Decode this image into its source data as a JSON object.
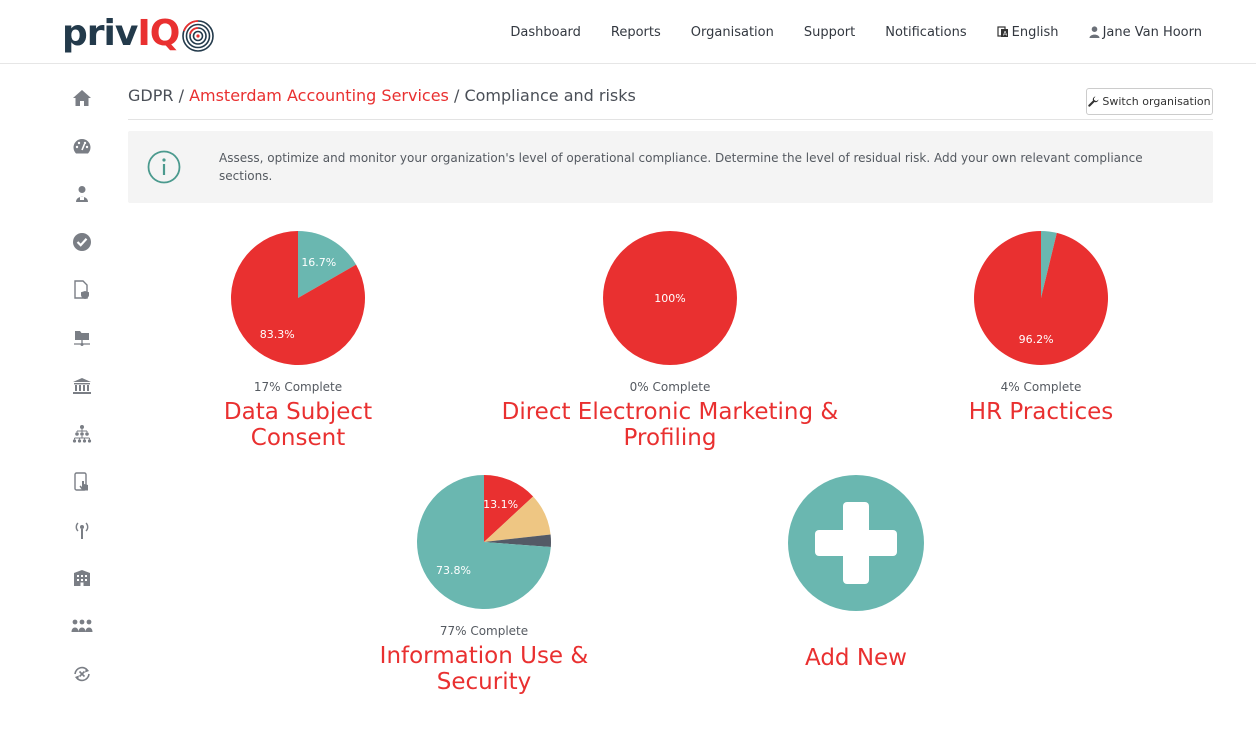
{
  "brand": {
    "logo_priv": "priv",
    "logo_iq": "IQ"
  },
  "nav": {
    "items": [
      {
        "name": "nav-dashboard",
        "label": "Dashboard"
      },
      {
        "name": "nav-reports",
        "label": "Reports"
      },
      {
        "name": "nav-organisation",
        "label": "Organisation"
      },
      {
        "name": "nav-support",
        "label": "Support"
      },
      {
        "name": "nav-notifications",
        "label": "Notifications"
      }
    ],
    "language": "English",
    "user": "Jane Van Hoorn"
  },
  "sidebar": {
    "icons": [
      "home-icon",
      "dashboard-gauge-icon",
      "user-icon",
      "check-circle-icon",
      "document-shield-icon",
      "folder-network-icon",
      "institution-icon",
      "org-chart-icon",
      "touch-device-icon",
      "broadcast-icon",
      "building-icon",
      "group-icon",
      "transfer-icon"
    ]
  },
  "breadcrumb": {
    "root": "GDPR",
    "organisation": "Amsterdam Accounting Services",
    "current": "Compliance and risks",
    "separator": "/"
  },
  "switch_button": {
    "label": "Switch organisation"
  },
  "info": {
    "text": "Assess, optimize and monitor your organization's level of operational compliance. Determine the level of residual risk. Add your own relevant compliance sections."
  },
  "colors": {
    "red": "#e93030",
    "teal": "#6ab7b0",
    "sand": "#eec683",
    "slate": "#545a66"
  },
  "sections": [
    {
      "title": "Data Subject Consent",
      "complete": "17% Complete"
    },
    {
      "title": "Direct Electronic Marketing & Profiling",
      "complete": "0% Complete"
    },
    {
      "title": "HR Practices",
      "complete": "4% Complete"
    },
    {
      "title": "Information Use & Security",
      "complete": "77% Complete"
    }
  ],
  "add_new": {
    "title": "Add New"
  },
  "chart_data": [
    {
      "type": "pie",
      "categories": [
        "",
        ""
      ],
      "values": [
        16.7,
        83.3
      ],
      "labels": [
        "16.7%",
        "83.3%"
      ],
      "colors": [
        "#6ab7b0",
        "#e93030"
      ]
    },
    {
      "type": "pie",
      "categories": [
        ""
      ],
      "values": [
        100
      ],
      "labels": [
        "100%"
      ],
      "colors": [
        "#e93030"
      ]
    },
    {
      "type": "pie",
      "categories": [
        "",
        ""
      ],
      "values": [
        3.8,
        96.2
      ],
      "labels": [
        "",
        "96.2%"
      ],
      "colors": [
        "#6ab7b0",
        "#e93030"
      ]
    },
    {
      "type": "pie",
      "categories": [
        "",
        "",
        "",
        ""
      ],
      "values": [
        13.1,
        10.1,
        3.0,
        73.8
      ],
      "labels": [
        "13.1%",
        "",
        "",
        "73.8%"
      ],
      "colors": [
        "#e93030",
        "#eec683",
        "#545a66",
        "#6ab7b0"
      ]
    }
  ]
}
